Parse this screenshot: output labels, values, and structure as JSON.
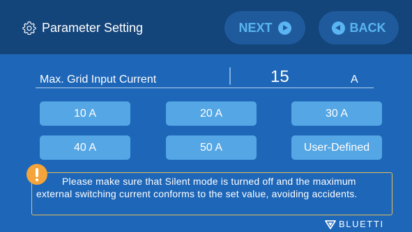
{
  "header": {
    "title": "Parameter Setting",
    "next_label": "NEXT",
    "back_label": "BACK"
  },
  "field": {
    "label": "Max. Grid Input Current",
    "value": "15",
    "unit": "A"
  },
  "options": [
    "10 A",
    "20 A",
    "30 A",
    "40 A",
    "50 A",
    "User-Defined"
  ],
  "warning": {
    "text": "Please make sure that Silent mode is turned off and the maximum external switching current conforms to the set value, avoiding accidents."
  },
  "brand": {
    "name": "BLUETTI"
  },
  "icons": {
    "settings": "gear-icon",
    "next": "play-circle-icon",
    "back": "back-circle-icon",
    "warning": "exclamation-icon",
    "brand": "bluetti-logo-icon"
  },
  "colors": {
    "background": "#1d66b8",
    "header": "#13447a",
    "nav_button": "#1f5b9c",
    "nav_text": "#5ab5f2",
    "option_button": "#55a6e5",
    "warning_border": "#e8bf5a",
    "warning_icon": "#f4a43a"
  }
}
